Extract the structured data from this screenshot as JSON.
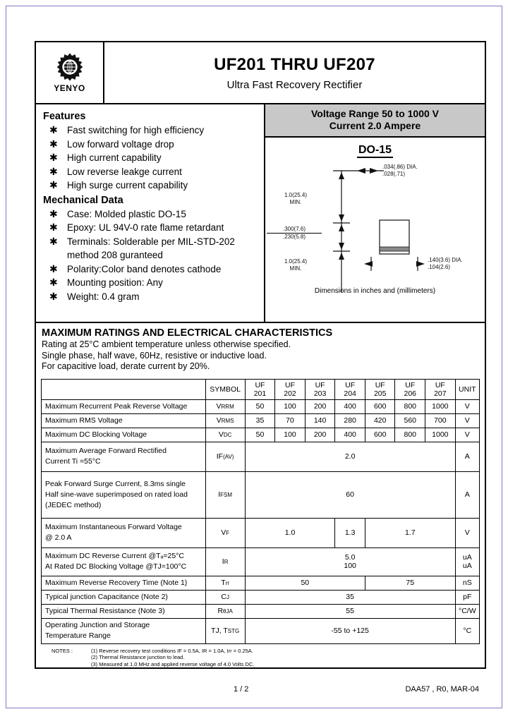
{
  "header": {
    "logo_text": "YENYO",
    "title": "UF201 THRU UF207",
    "subtitle": "Ultra Fast Recovery Rectifier"
  },
  "features": {
    "heading": "Features",
    "items": [
      "Fast switching for high efficiency",
      "Low forward voltage drop",
      "High current capability",
      "Low reverse leakge current",
      "High surge current capability"
    ],
    "mech_heading": "Mechanical Data",
    "mech_items": [
      "Case: Molded plastic DO-15",
      "Epoxy: UL 94V-0 rate flame retardant",
      "Terminals: Solderable per MIL-STD-202",
      "Polarity:Color band denotes cathode",
      "Mounting position: Any",
      "Weight: 0.4 gram"
    ],
    "mech_item_3_cont": "method 208 guranteed",
    "bullet": "✱"
  },
  "package": {
    "voltage_range_line1": "Voltage Range 50 to 1000 V",
    "voltage_range_line2": "Current 2.0 Ampere",
    "name": "DO-15",
    "dim_note": "Dimensions in inches and (millimeters)",
    "dims": {
      "lead_dia_max": ".034(.86)",
      "lead_dia_min": ".028(.71)",
      "lead_dia_label": "DIA.",
      "lead_len_top": "1.0(25.4)",
      "lead_len_top_min": "MIN.",
      "body_len_max": ".300(7.6)",
      "body_len_min": ".230(5.8)",
      "lead_len_bot": "1.0(25.4)",
      "lead_len_bot_min": "MIN.",
      "body_dia_max": ".140(3.6)",
      "body_dia_min": ".104(2.6)",
      "body_dia_label": "DIA."
    }
  },
  "ratings": {
    "heading": "MAXIMUM RATINGS AND ELECTRICAL CHARACTERISTICS",
    "lines": [
      "Rating at 25°C ambient temperature unless otherwise specified.",
      "Single phase, half wave, 60Hz, resistive or inductive load.",
      "For capacitive load, derate current by 20%."
    ]
  },
  "table": {
    "headers": {
      "symbol": "SYMBOL",
      "parts": [
        "UF\n201",
        "UF\n202",
        "UF\n203",
        "UF\n204",
        "UF\n205",
        "UF\n206",
        "UF\n207"
      ],
      "part_prefix": "UF",
      "part_numbers": [
        "201",
        "202",
        "203",
        "204",
        "205",
        "206",
        "207"
      ],
      "unit": "UNIT"
    },
    "rows": [
      {
        "param": "Maximum Recurrent Peak Reverse Voltage",
        "symbol": "VRRM",
        "symbol_base": "V",
        "symbol_sub": "RRM",
        "values": [
          "50",
          "100",
          "200",
          "400",
          "600",
          "800",
          "1000"
        ],
        "unit": "V"
      },
      {
        "param": "Maximum RMS Voltage",
        "symbol": "VRMS",
        "symbol_base": "V",
        "symbol_sub": "RMS",
        "values": [
          "35",
          "70",
          "140",
          "280",
          "420",
          "560",
          "700"
        ],
        "unit": "V"
      },
      {
        "param": "Maximum DC Blocking Voltage",
        "symbol": "VDC",
        "symbol_base": "V",
        "symbol_sub": "DC",
        "values": [
          "50",
          "100",
          "200",
          "400",
          "600",
          "800",
          "1000"
        ],
        "unit": "V"
      }
    ],
    "row_ifav": {
      "param_line1": "Maximum Average Forward Rectified",
      "param_line2": "Current Ti =55°C",
      "symbol_base": "IF",
      "symbol_sub": "(AV)",
      "value": "2.0",
      "unit": "A"
    },
    "row_ifsm": {
      "param_line1": "Peak Forward Surge Current, 8.3ms single",
      "param_line2": "Half sine-wave superimposed on rated load",
      "param_line3": "(JEDEC method)",
      "symbol_base": "I",
      "symbol_sub": "FSM",
      "value": "60",
      "unit": "A"
    },
    "row_vf": {
      "param_line1": "Maximum Instantaneous Forward Voltage",
      "param_line2": "@ 2.0 A",
      "symbol_base": "V",
      "symbol_sub": "F",
      "values": [
        "1.0",
        "1.3",
        "1.7"
      ],
      "unit": "V"
    },
    "row_ir": {
      "param_line1": "Maximum DC Reverse Current  @Tₐ=25°C",
      "param_line2": "At Rated DC Blocking Voltage @TJ=100°C",
      "symbol_base": "I",
      "symbol_sub": "R",
      "value1": "5.0",
      "value2": "100",
      "unit1": "uA",
      "unit2": "uA"
    },
    "row_trr": {
      "param": "Maximum Reverse Recovery Time (Note 1)",
      "symbol_base": "T",
      "symbol_sub": "rr",
      "value1": "50",
      "value2": "75",
      "unit": "nS"
    },
    "row_cj": {
      "param": "Typical junction Capacitance (Note 2)",
      "symbol_base": "C",
      "symbol_sub": "J",
      "value": "35",
      "unit": "pF"
    },
    "row_rth": {
      "param": "Typical Thermal Resistance (Note 3)",
      "symbol_base": "R",
      "symbol_sub": "θJA",
      "value": "55",
      "unit": "°C/W"
    },
    "row_temp": {
      "param_line1": "Operating Junction and Storage",
      "param_line2": "Temperature Range",
      "symbol_base": "TJ, T",
      "symbol_sub": "STG",
      "value": "-55 to +125",
      "unit": "°C"
    }
  },
  "notes": {
    "label": "NOTES :",
    "items": [
      "(1) Reverse recovery test conditions IF = 0.5A, IR = 1.0A, Irr = 0.25A.",
      "(2) Thermal Resistance junction to lead.",
      "(3) Measured at 1.0 MHz and applied reverse voltage of 4.0 Volts DC."
    ]
  },
  "footer": {
    "page": "1 / 2",
    "doc_code": "DAA57 , R0, MAR-04"
  }
}
